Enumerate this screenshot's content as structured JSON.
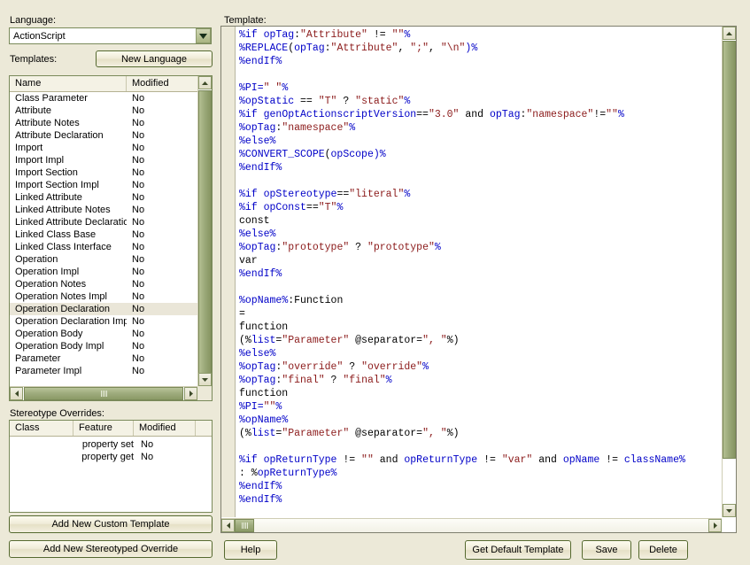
{
  "left_panel": {
    "language_label": "Language:",
    "language_value": "ActionScript",
    "templates_label": "Templates:",
    "new_language_button": "New Language",
    "templates_table": {
      "columns": [
        "Name",
        "Modified"
      ],
      "rows": [
        {
          "name": "Class Parameter",
          "modified": "No",
          "selected": false
        },
        {
          "name": "Attribute",
          "modified": "No",
          "selected": false
        },
        {
          "name": "Attribute Notes",
          "modified": "No",
          "selected": false
        },
        {
          "name": "Attribute Declaration",
          "modified": "No",
          "selected": false
        },
        {
          "name": "Import",
          "modified": "No",
          "selected": false
        },
        {
          "name": "Import Impl",
          "modified": "No",
          "selected": false
        },
        {
          "name": "Import Section",
          "modified": "No",
          "selected": false
        },
        {
          "name": "Import Section Impl",
          "modified": "No",
          "selected": false
        },
        {
          "name": "Linked Attribute",
          "modified": "No",
          "selected": false
        },
        {
          "name": "Linked Attribute Notes",
          "modified": "No",
          "selected": false
        },
        {
          "name": "Linked Attribute Declaration",
          "modified": "No",
          "selected": false
        },
        {
          "name": "Linked Class Base",
          "modified": "No",
          "selected": false
        },
        {
          "name": "Linked Class Interface",
          "modified": "No",
          "selected": false
        },
        {
          "name": "Operation",
          "modified": "No",
          "selected": false
        },
        {
          "name": "Operation Impl",
          "modified": "No",
          "selected": false
        },
        {
          "name": "Operation Notes",
          "modified": "No",
          "selected": false
        },
        {
          "name": "Operation Notes Impl",
          "modified": "No",
          "selected": false
        },
        {
          "name": "Operation Declaration",
          "modified": "No",
          "selected": true
        },
        {
          "name": "Operation Declaration Impl",
          "modified": "No",
          "selected": false
        },
        {
          "name": "Operation Body",
          "modified": "No",
          "selected": false
        },
        {
          "name": "Operation Body Impl",
          "modified": "No",
          "selected": false
        },
        {
          "name": "Parameter",
          "modified": "No",
          "selected": false
        },
        {
          "name": "Parameter Impl",
          "modified": "No",
          "selected": false
        }
      ]
    },
    "stereotype_label": "Stereotype Overrides:",
    "stereotype_table": {
      "columns": [
        "Class",
        "Feature",
        "Modified"
      ],
      "rows": [
        {
          "class": "",
          "feature": "property set",
          "modified": "No"
        },
        {
          "class": "",
          "feature": "property get",
          "modified": "No"
        }
      ]
    },
    "add_custom_template_button": "Add New Custom Template",
    "add_stereotyped_override_button": "Add New Stereotyped Override"
  },
  "right_panel": {
    "template_label": "Template:",
    "code_lines": [
      [
        {
          "t": "%if ",
          "c": "k"
        },
        {
          "t": "opTag",
          "c": "k"
        },
        {
          "t": ":",
          "c": "t"
        },
        {
          "t": "\"Attribute\"",
          "c": "s"
        },
        {
          "t": " != ",
          "c": "t"
        },
        {
          "t": "\"\"",
          "c": "s"
        },
        {
          "t": "%",
          "c": "k"
        }
      ],
      [
        {
          "t": "%REPLACE",
          "c": "k"
        },
        {
          "t": "(",
          "c": "t"
        },
        {
          "t": "opTag",
          "c": "k"
        },
        {
          "t": ":",
          "c": "t"
        },
        {
          "t": "\"Attribute\"",
          "c": "s"
        },
        {
          "t": ", ",
          "c": "t"
        },
        {
          "t": "\";\"",
          "c": "s"
        },
        {
          "t": ", ",
          "c": "t"
        },
        {
          "t": "\"\\n\"",
          "c": "s"
        },
        {
          "t": ")%",
          "c": "k"
        }
      ],
      [
        {
          "t": "%endIf%",
          "c": "k"
        }
      ],
      [],
      [
        {
          "t": "%PI=",
          "c": "k"
        },
        {
          "t": "\" \"",
          "c": "s"
        },
        {
          "t": "%",
          "c": "k"
        }
      ],
      [
        {
          "t": "%",
          "c": "k"
        },
        {
          "t": "opStatic",
          "c": "k"
        },
        {
          "t": " == ",
          "c": "t"
        },
        {
          "t": "\"T\"",
          "c": "s"
        },
        {
          "t": " ? ",
          "c": "t"
        },
        {
          "t": "\"static\"",
          "c": "s"
        },
        {
          "t": "%",
          "c": "k"
        }
      ],
      [
        {
          "t": "%if ",
          "c": "k"
        },
        {
          "t": "genOptActionscriptVersion",
          "c": "k"
        },
        {
          "t": "==",
          "c": "t"
        },
        {
          "t": "\"3.0\"",
          "c": "s"
        },
        {
          "t": " and ",
          "c": "t"
        },
        {
          "t": "opTag",
          "c": "k"
        },
        {
          "t": ":",
          "c": "t"
        },
        {
          "t": "\"namespace\"",
          "c": "s"
        },
        {
          "t": "!=",
          "c": "t"
        },
        {
          "t": "\"\"",
          "c": "s"
        },
        {
          "t": "%",
          "c": "k"
        }
      ],
      [
        {
          "t": "%",
          "c": "k"
        },
        {
          "t": "opTag",
          "c": "k"
        },
        {
          "t": ":",
          "c": "t"
        },
        {
          "t": "\"namespace\"",
          "c": "s"
        },
        {
          "t": "%",
          "c": "k"
        }
      ],
      [
        {
          "t": "%else%",
          "c": "k"
        }
      ],
      [
        {
          "t": "%CONVERT_SCOPE",
          "c": "k"
        },
        {
          "t": "(",
          "c": "t"
        },
        {
          "t": "opScope",
          "c": "k"
        },
        {
          "t": ")%",
          "c": "k"
        }
      ],
      [
        {
          "t": "%endIf%",
          "c": "k"
        }
      ],
      [],
      [
        {
          "t": "%if ",
          "c": "k"
        },
        {
          "t": "opStereotype",
          "c": "k"
        },
        {
          "t": "==",
          "c": "t"
        },
        {
          "t": "\"literal\"",
          "c": "s"
        },
        {
          "t": "%",
          "c": "k"
        }
      ],
      [
        {
          "t": "%if ",
          "c": "k"
        },
        {
          "t": "opConst",
          "c": "k"
        },
        {
          "t": "==",
          "c": "t"
        },
        {
          "t": "\"T\"",
          "c": "s"
        },
        {
          "t": "%",
          "c": "k"
        }
      ],
      [
        {
          "t": "const",
          "c": "t"
        }
      ],
      [
        {
          "t": "%else%",
          "c": "k"
        }
      ],
      [
        {
          "t": "%",
          "c": "k"
        },
        {
          "t": "opTag",
          "c": "k"
        },
        {
          "t": ":",
          "c": "t"
        },
        {
          "t": "\"prototype\"",
          "c": "s"
        },
        {
          "t": " ? ",
          "c": "t"
        },
        {
          "t": "\"prototype\"",
          "c": "s"
        },
        {
          "t": "%",
          "c": "k"
        }
      ],
      [
        {
          "t": "var",
          "c": "t"
        }
      ],
      [
        {
          "t": "%endIf%",
          "c": "k"
        }
      ],
      [],
      [
        {
          "t": "%",
          "c": "k"
        },
        {
          "t": "opName",
          "c": "k"
        },
        {
          "t": "%",
          "c": "k"
        },
        {
          "t": ":Function",
          "c": "t"
        }
      ],
      [
        {
          "t": "=",
          "c": "t"
        }
      ],
      [
        {
          "t": "function",
          "c": "t"
        }
      ],
      [
        {
          "t": "(%",
          "c": "t"
        },
        {
          "t": "list",
          "c": "k"
        },
        {
          "t": "=",
          "c": "t"
        },
        {
          "t": "\"Parameter\"",
          "c": "s"
        },
        {
          "t": " @separator=",
          "c": "t"
        },
        {
          "t": "\", \"",
          "c": "s"
        },
        {
          "t": "%)",
          "c": "t"
        }
      ],
      [
        {
          "t": "%else%",
          "c": "k"
        }
      ],
      [
        {
          "t": "%",
          "c": "k"
        },
        {
          "t": "opTag",
          "c": "k"
        },
        {
          "t": ":",
          "c": "t"
        },
        {
          "t": "\"override\"",
          "c": "s"
        },
        {
          "t": " ? ",
          "c": "t"
        },
        {
          "t": "\"override\"",
          "c": "s"
        },
        {
          "t": "%",
          "c": "k"
        }
      ],
      [
        {
          "t": "%",
          "c": "k"
        },
        {
          "t": "opTag",
          "c": "k"
        },
        {
          "t": ":",
          "c": "t"
        },
        {
          "t": "\"final\"",
          "c": "s"
        },
        {
          "t": " ? ",
          "c": "t"
        },
        {
          "t": "\"final\"",
          "c": "s"
        },
        {
          "t": "%",
          "c": "k"
        }
      ],
      [
        {
          "t": "function",
          "c": "t"
        }
      ],
      [
        {
          "t": "%PI=",
          "c": "k"
        },
        {
          "t": "\"\"",
          "c": "s"
        },
        {
          "t": "%",
          "c": "k"
        }
      ],
      [
        {
          "t": "%",
          "c": "k"
        },
        {
          "t": "opName",
          "c": "k"
        },
        {
          "t": "%",
          "c": "k"
        }
      ],
      [
        {
          "t": "(%",
          "c": "t"
        },
        {
          "t": "list",
          "c": "k"
        },
        {
          "t": "=",
          "c": "t"
        },
        {
          "t": "\"Parameter\"",
          "c": "s"
        },
        {
          "t": " @separator=",
          "c": "t"
        },
        {
          "t": "\", \"",
          "c": "s"
        },
        {
          "t": "%)",
          "c": "t"
        }
      ],
      [],
      [
        {
          "t": "%if ",
          "c": "k"
        },
        {
          "t": "opReturnType",
          "c": "k"
        },
        {
          "t": " != ",
          "c": "t"
        },
        {
          "t": "\"\"",
          "c": "s"
        },
        {
          "t": " and ",
          "c": "t"
        },
        {
          "t": "opReturnType",
          "c": "k"
        },
        {
          "t": " != ",
          "c": "t"
        },
        {
          "t": "\"var\"",
          "c": "s"
        },
        {
          "t": " and ",
          "c": "t"
        },
        {
          "t": "opName",
          "c": "k"
        },
        {
          "t": " != ",
          "c": "t"
        },
        {
          "t": "className",
          "c": "k"
        },
        {
          "t": "%",
          "c": "k"
        }
      ],
      [
        {
          "t": ": %",
          "c": "t"
        },
        {
          "t": "opReturnType",
          "c": "k"
        },
        {
          "t": "%",
          "c": "k"
        }
      ],
      [
        {
          "t": "%endIf%",
          "c": "k"
        }
      ],
      [
        {
          "t": "%endIf%",
          "c": "k"
        }
      ]
    ]
  },
  "footer": {
    "help_button": "Help",
    "get_default_template_button": "Get Default Template",
    "save_button": "Save",
    "delete_button": "Delete"
  },
  "colors": {
    "window_bg": "#ece9d8",
    "field_bg": "#ffffff",
    "border_green": "#7a8a5a",
    "button_border": "#55692f",
    "selection": "#eae6d8",
    "code_keyword": "#0000c8",
    "code_string": "#8b1a1a",
    "scrollbar_thumb": "#9daa7c"
  }
}
